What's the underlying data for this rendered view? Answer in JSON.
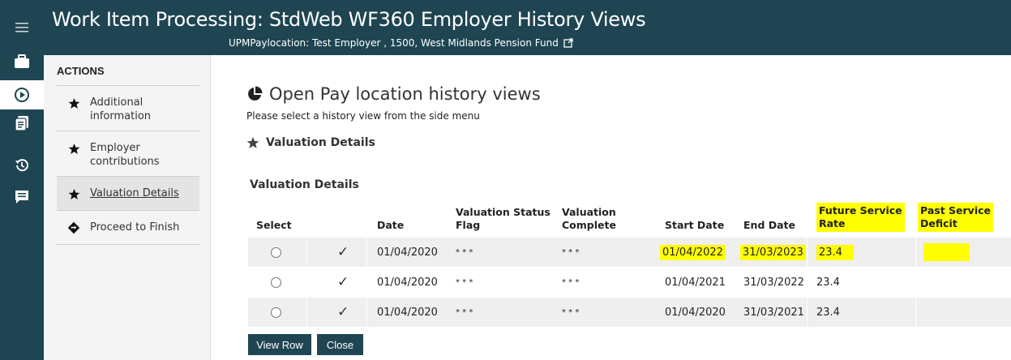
{
  "colors": {
    "brand": "#1f4552",
    "highlight": "#ffff00",
    "row_alt": "#efefef"
  },
  "header": {
    "title": "Work Item Processing: StdWeb WF360 Employer History Views",
    "subtitle": "UPMPaylocation: Test Employer , 1500, West Midlands Pension Fund",
    "subtitle_icon": "external-link-icon"
  },
  "rail": {
    "items": [
      {
        "icon": "menu-icon",
        "active": false
      },
      {
        "icon": "briefcase-icon",
        "active": false
      },
      {
        "icon": "play-circle-icon",
        "active": true
      },
      {
        "icon": "documents-icon",
        "active": false
      },
      {
        "icon": "history-icon",
        "active": false
      },
      {
        "icon": "comment-icon",
        "active": false
      }
    ]
  },
  "actions": {
    "heading": "ACTIONS",
    "items": [
      {
        "line1": "Additional",
        "line2": "information",
        "icon": "star-icon"
      },
      {
        "line1": "Employer",
        "line2": "contributions",
        "icon": "star-icon"
      },
      {
        "line1": "Valuation Details",
        "line2": "",
        "icon": "star-icon"
      },
      {
        "line1": "Proceed to Finish",
        "line2": "",
        "icon": "diamond-arrow-icon"
      }
    ]
  },
  "main": {
    "title": "Open Pay location history views",
    "hint": "Please select a history view from the side menu",
    "section": "Valuation Details",
    "table_caption": "Valuation Details"
  },
  "table": {
    "headers": {
      "select": "Select",
      "date": "Date",
      "status_1": "Valuation Status",
      "status_2": "Flag",
      "complete_1": "Valuation",
      "complete_2": "Complete",
      "start": "Start Date",
      "end": "End Date",
      "future_1": "Future Service",
      "future_2": "Rate",
      "past_1": "Past Service",
      "past_2": "Deficit"
    },
    "rows": [
      {
        "tick": "✓",
        "date": "01/04/2020",
        "status": "* * *",
        "complete": "* * *",
        "start": "01/04/2022",
        "end": "31/03/2023",
        "future": "23.4",
        "past": ""
      },
      {
        "tick": "✓",
        "date": "01/04/2020",
        "status": "* * *",
        "complete": "* * *",
        "start": "01/04/2021",
        "end": "31/03/2022",
        "future": "23.4",
        "past": ""
      },
      {
        "tick": "✓",
        "date": "01/04/2020",
        "status": "* * *",
        "complete": "* * *",
        "start": "01/04/2020",
        "end": "31/03/2021",
        "future": "23.4",
        "past": ""
      }
    ]
  },
  "buttons": {
    "view_row": "View Row",
    "close": "Close"
  }
}
